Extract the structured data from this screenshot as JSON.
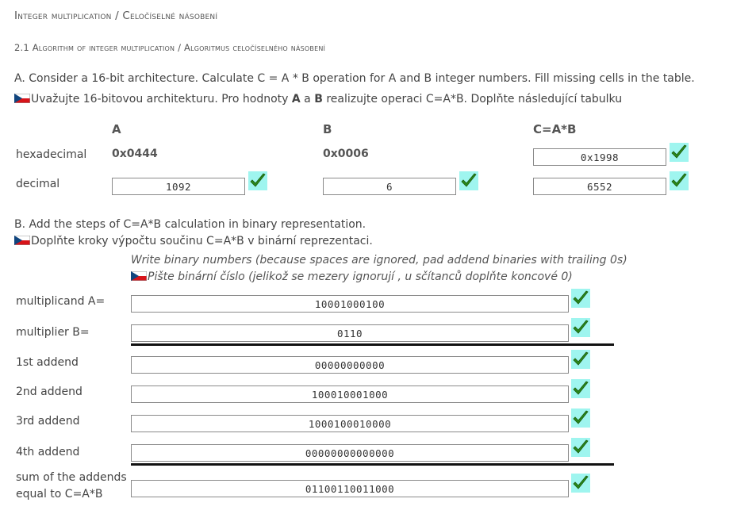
{
  "headings": {
    "title": "Integer multiplication / Celočíselné násobení",
    "subtitle": "2.1 Algorithm of integer multiplication / Algoritmus celočíselného násobení"
  },
  "partA": {
    "instruction_en": "A. Consider a 16-bit architecture. Calculate  C = A * B operation for A and B integer numbers. Fill missing cells in the table.",
    "instruction_cz_1": "Uvažujte 16-bitovou architekturu. Pro hodnoty ",
    "instruction_cz_A": "A",
    "instruction_cz_2": " a ",
    "instruction_cz_B": "B",
    "instruction_cz_3": " realizujte operaci C=A*B. Doplňte následující tabulku",
    "col_a": "A",
    "col_b": "B",
    "col_c": "C=A*B",
    "row_hex_label": "hexadecimal",
    "row_dec_label": "decimal",
    "a_hex": "0x0444",
    "b_hex": "0x0006",
    "c_hex": "0x1998",
    "a_dec": "1092",
    "b_dec": "6",
    "c_dec": "6552"
  },
  "partB": {
    "instruction_en": "B. Add the steps of  C=A*B calculation in binary representation.",
    "instruction_cz": "Doplňte kroky výpočtu součinu C=A*B v binární reprezentaci.",
    "hint_en": "Write binary numbers (because spaces are ignored, pad addend binaries with trailing 0s)",
    "hint_cz": "Pište binární číslo  (jelikož se mezery ignorují , u sčítanců doplňte koncové 0)",
    "multiplicand_label": "multiplicand A=",
    "multiplicand_value": "10001000100",
    "multiplier_label": "multiplier B=",
    "multiplier_value": "0110",
    "addend1_label": "1st addend",
    "addend1_value": "00000000000",
    "addend2_label": "2nd addend",
    "addend2_value": "100010001000",
    "addend3_label": "3rd addend",
    "addend3_value": "1000100010000",
    "addend4_label": "4th addend",
    "addend4_value": "00000000000000",
    "sum_label_1": "sum of the addends",
    "sum_label_2": "equal to C=A*B",
    "sum_value": "01100110011000"
  },
  "icons": {
    "check": "check-mark-icon",
    "flag": "czech-flag-icon"
  },
  "colors": {
    "check_bg": "#9ff5ef",
    "check_fill": "#2a8a1a"
  }
}
